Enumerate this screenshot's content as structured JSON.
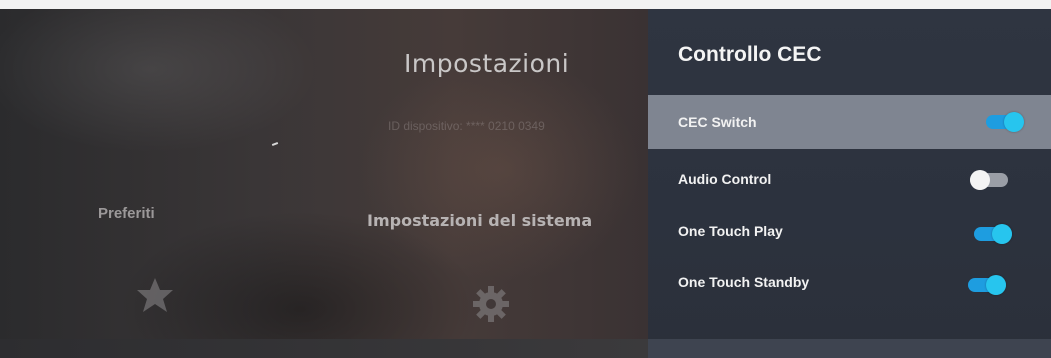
{
  "screen": {
    "title": "Impostazioni",
    "device_id": "ID dispositivo: **** 0210 0349"
  },
  "menu": {
    "items": [
      {
        "label": "Preferiti",
        "icon": "star-icon"
      },
      {
        "label": "Impostazioni del sistema",
        "icon": "gear-icon"
      }
    ]
  },
  "panel": {
    "title": "Controllo CEC",
    "options": [
      {
        "label": "CEC Switch",
        "enabled": true,
        "selected": true
      },
      {
        "label": "Audio Control",
        "enabled": false,
        "selected": false
      },
      {
        "label": "One Touch Play",
        "enabled": true,
        "selected": false
      },
      {
        "label": "One Touch Standby",
        "enabled": true,
        "selected": false
      }
    ]
  },
  "colors": {
    "toggle_on": "#1e9de0",
    "toggle_knob_on": "#27c5ee",
    "toggle_off": "#9a9ea6",
    "selected_row": "#7f8591",
    "panel_background": "#2f3541"
  }
}
